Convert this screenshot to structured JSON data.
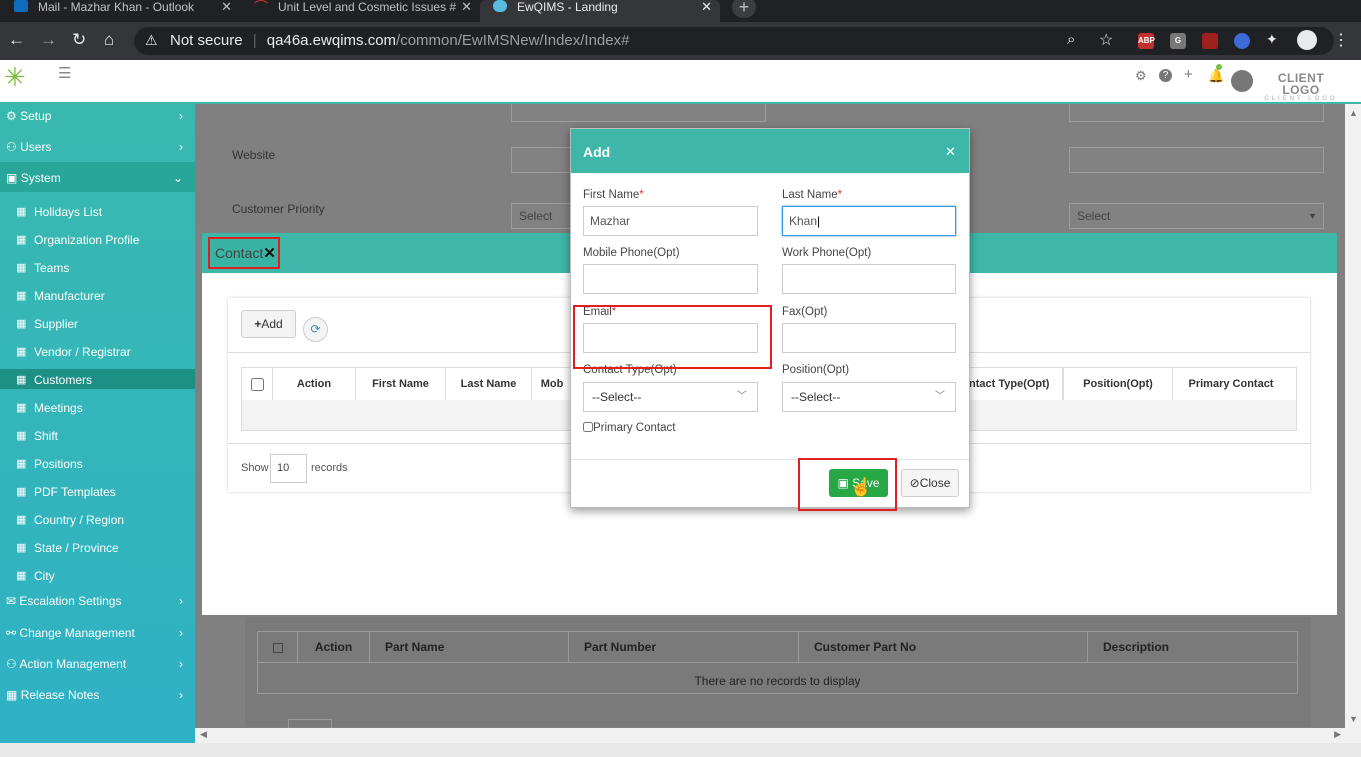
{
  "browser": {
    "tabs": [
      {
        "title": "Mail - Mazhar Khan - Outlook"
      },
      {
        "title": "Unit Level and Cosmetic Issues #"
      },
      {
        "title": "EwQIMS - Landing"
      }
    ],
    "new_tab": "+",
    "security_label": "Not secure",
    "url_host": "qa46a.ewqims.com",
    "url_path": "/common/EwIMSNew/Index/Index#",
    "extensions": [
      "ABP",
      "G"
    ]
  },
  "app_header": {
    "client_logo": "CLIENT LOGO",
    "client_logo_sub": "CLIENT LOGO"
  },
  "sidebar": {
    "top_items": [
      {
        "label": "Setup"
      },
      {
        "label": "Users"
      },
      {
        "label": "System"
      }
    ],
    "system_items": [
      {
        "label": "Holidays List"
      },
      {
        "label": "Organization Profile"
      },
      {
        "label": "Teams"
      },
      {
        "label": "Manufacturer"
      },
      {
        "label": "Supplier"
      },
      {
        "label": "Vendor / Registrar"
      },
      {
        "label": "Customers"
      },
      {
        "label": "Meetings"
      },
      {
        "label": "Shift"
      },
      {
        "label": "Positions"
      },
      {
        "label": "PDF Templates"
      },
      {
        "label": "Country / Region"
      },
      {
        "label": "State / Province"
      },
      {
        "label": "City"
      }
    ],
    "bottom_items": [
      {
        "label": "Escalation Settings"
      },
      {
        "label": "Change Management"
      },
      {
        "label": "Action Management"
      },
      {
        "label": "Release Notes"
      }
    ]
  },
  "background_form": {
    "website_label": "Website",
    "priority_label": "Customer Priority",
    "select_placeholder": "Select"
  },
  "contact_panel": {
    "title": "Contact",
    "add_button": "Add",
    "columns": [
      "Action",
      "First Name",
      "Last Name",
      "Mob",
      "ntact Type(Opt)",
      "Position(Opt)",
      "Primary Contact"
    ],
    "show_label": "Show",
    "page_size": "10",
    "records_label": "records"
  },
  "parts_table": {
    "columns": [
      "Action",
      "Part Name",
      "Part Number",
      "Customer Part No",
      "Description"
    ],
    "empty_message": "There are no records to display"
  },
  "modal": {
    "title": "Add",
    "first_name_label": "First Name",
    "first_name_value": "Mazhar",
    "last_name_label": "Last Name",
    "last_name_value": "Khan",
    "mobile_label": "Mobile Phone(Opt)",
    "work_label": "Work Phone(Opt)",
    "email_label": "Email",
    "fax_label": "Fax(Opt)",
    "contact_type_label": "Contact Type(Opt)",
    "contact_type_value": "--Select--",
    "position_label": "Position(Opt)",
    "position_value": "--Select--",
    "primary_contact_label": "Primary Contact",
    "required_mark": "*",
    "save_button": "Save",
    "close_button": "Close"
  }
}
